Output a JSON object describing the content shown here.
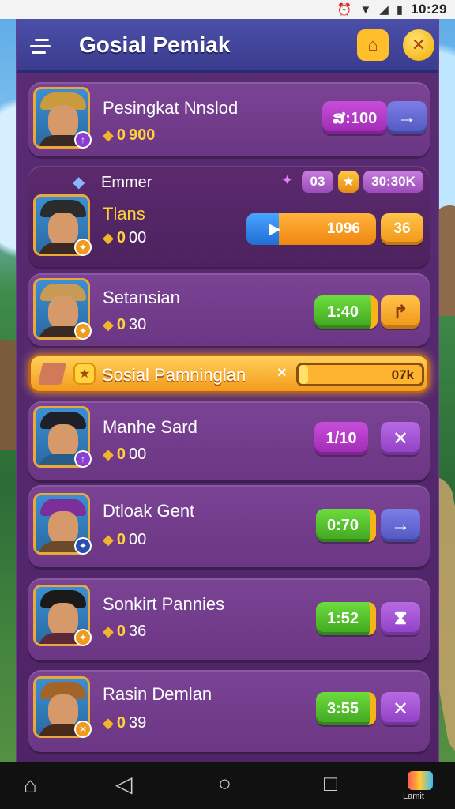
{
  "status_bar": {
    "time": "10:29"
  },
  "header": {
    "title": "Gosial Pemiak",
    "home_icon": "home-icon",
    "close_icon": "close-icon"
  },
  "rows": [
    {
      "name": "Pesingkat Nnslod",
      "score_lead": "0",
      "score_rest": "900",
      "pill": "ສ:100",
      "action": "→"
    },
    {
      "name": "Emmer",
      "subname": "Tlans",
      "score_lead": "0",
      "score_rest": "00",
      "chip_a": "03",
      "chip_b": "30:30K",
      "progress_value": "1096",
      "progress_fraction": 0.25,
      "action": "36"
    },
    {
      "name": "Setansian",
      "score_lead": "0",
      "score_rest": "30",
      "pill": "1:40",
      "action": "↱"
    },
    {
      "name": "Manhe Sard",
      "score_lead": "0",
      "score_rest": "00",
      "pill": "1/10",
      "action": "✕"
    },
    {
      "name": "Dtloak Gent",
      "score_lead": "0",
      "score_rest": "00",
      "pill": "0:70",
      "action": "→"
    },
    {
      "name": "Sonkirt Pannies",
      "score_lead": "0",
      "score_rest": "36",
      "pill": "1:52",
      "action": "⧗"
    },
    {
      "name": "Rasin Demlan",
      "score_lead": "0",
      "score_rest": "39",
      "pill": "3:55",
      "action": "✕"
    }
  ],
  "banner": {
    "title": "Sosial Pamninglan",
    "value": "07k",
    "fraction": 0.08
  },
  "nav": {
    "game_label": "Lamit"
  },
  "colors": {
    "panel": "#5a2c74",
    "header": "#3b3c8f",
    "accent_gold": "#ffbf2a",
    "green": "#3fa521"
  }
}
